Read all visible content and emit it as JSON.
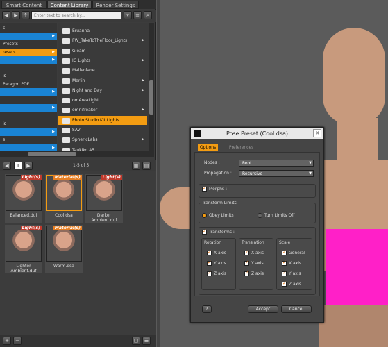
{
  "tabs": [
    "Smart Content",
    "Content Library",
    "Render Settings"
  ],
  "search": {
    "placeholder": "Enter text to search by..."
  },
  "tree": [
    {
      "label": "c",
      "style": "plain"
    },
    {
      "label": "",
      "style": "blue"
    },
    {
      "label": "Presets",
      "style": "plain"
    },
    {
      "label": "resets",
      "style": "orange"
    },
    {
      "label": "",
      "style": "blue"
    },
    {
      "label": "",
      "style": "plain"
    },
    {
      "label": "is",
      "style": "plain"
    },
    {
      "label": "Paragon PDF",
      "style": "plain"
    },
    {
      "label": "",
      "style": "blue"
    },
    {
      "label": "",
      "style": "plain"
    },
    {
      "label": "",
      "style": "blue"
    },
    {
      "label": "",
      "style": "plain"
    },
    {
      "label": "is",
      "style": "plain"
    },
    {
      "label": "",
      "style": "blue"
    },
    {
      "label": "s",
      "style": "plain"
    },
    {
      "label": "",
      "style": "blue"
    }
  ],
  "folders": [
    {
      "label": "Eruanna",
      "arrow": false,
      "selected": false
    },
    {
      "label": "FW_TakeToTheFloor_Lights",
      "arrow": true,
      "selected": false
    },
    {
      "label": "Gleam",
      "arrow": false,
      "selected": false
    },
    {
      "label": "IG Lights",
      "arrow": true,
      "selected": false
    },
    {
      "label": "Mallenlane",
      "arrow": false,
      "selected": false
    },
    {
      "label": "Merlin",
      "arrow": true,
      "selected": false
    },
    {
      "label": "Night and Day",
      "arrow": true,
      "selected": false
    },
    {
      "label": "omAreaLight",
      "arrow": false,
      "selected": false
    },
    {
      "label": "omnifreaker",
      "arrow": true,
      "selected": false
    },
    {
      "label": "Photo Studio Kit Lights",
      "arrow": false,
      "selected": true
    },
    {
      "label": "SAV",
      "arrow": false,
      "selected": false
    },
    {
      "label": "SphericLabs",
      "arrow": true,
      "selected": false
    },
    {
      "label": "Taukiko A5",
      "arrow": false,
      "selected": false
    }
  ],
  "pager": {
    "page": "1",
    "count": "1-5 of 5"
  },
  "presets": [
    {
      "name": "Balanced.duf",
      "tag": "Light(s)",
      "kind": "light",
      "selected": false
    },
    {
      "name": "Cool.dsa",
      "tag": "Material(s)",
      "kind": "material",
      "selected": true
    },
    {
      "name": "Darker Ambient.duf",
      "tag": "Light(s)",
      "kind": "light",
      "selected": false
    },
    {
      "name": "Lighter Ambient.duf",
      "tag": "Light(s)",
      "kind": "light",
      "selected": false
    },
    {
      "name": "Warm.dsa",
      "tag": "Material(s)",
      "kind": "material",
      "selected": false
    }
  ],
  "dialog": {
    "title": "Pose Preset (Cool.dsa)",
    "tab_options": "Options",
    "tab_preferences": "Preferences",
    "nodes_label": "Nodes :",
    "nodes_value": "Root",
    "propagation_label": "Propagation :",
    "propagation_value": "Recursive",
    "morphs_label": "Morphs :",
    "transform_limits_label": "Transform Limits",
    "obey_limits": "Obey Limits",
    "turn_limits_off": "Turn Limits Off",
    "transforms_label": "Transforms :",
    "rotation_label": "Rotation",
    "translation_label": "Translation",
    "scale_label": "Scale",
    "x_axis": "X axis",
    "y_axis": "Y axis",
    "z_axis": "Z axis",
    "general": "General",
    "accept": "Accept",
    "cancel": "Cancel"
  },
  "colors": {
    "accent": "#f39c12",
    "select_blue": "#1a84d4",
    "garment_pink": "#ff20c8"
  }
}
